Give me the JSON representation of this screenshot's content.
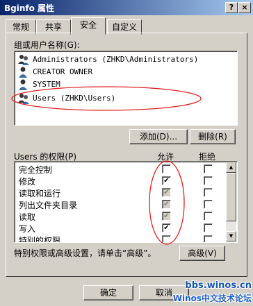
{
  "window": {
    "title": "Bginfo 属性",
    "help_button": "?",
    "close_button": "×"
  },
  "tabs": [
    {
      "label": "常规"
    },
    {
      "label": "共享"
    },
    {
      "label": "安全",
      "active": true
    },
    {
      "label": "自定义"
    }
  ],
  "users_group": {
    "label": "组或用户名称(G):",
    "items": [
      {
        "name": "Administrators (ZHKD\\Administrators)"
      },
      {
        "name": "CREATOR OWNER"
      },
      {
        "name": "SYSTEM"
      },
      {
        "name": "Users (ZHKD\\Users)",
        "selected": true
      }
    ],
    "add_button": "添加(D)...",
    "remove_button": "删除(R)"
  },
  "permissions": {
    "label": "Users 的权限(P)",
    "allow_header": "允许",
    "deny_header": "拒绝",
    "rows": [
      {
        "name": "完全控制",
        "allow": "",
        "deny": ""
      },
      {
        "name": "修改",
        "allow": "✔",
        "deny": ""
      },
      {
        "name": "读取和运行",
        "allow": "✔",
        "deny": ""
      },
      {
        "name": "列出文件夹目录",
        "allow": "✔",
        "deny": ""
      },
      {
        "name": "读取",
        "allow": "✔",
        "deny": ""
      },
      {
        "name": "写入",
        "allow": "✔",
        "deny": ""
      },
      {
        "name": "特别的权限",
        "allow": "",
        "deny": ""
      }
    ]
  },
  "advanced": {
    "hint": "特别权限或高级设置，请单击“高级”。",
    "button": "高级(V)"
  },
  "footer": {
    "ok_button": "确定",
    "cancel_button": "取消"
  },
  "watermark": {
    "line1": "bbs.winos.cn",
    "line2": "Winos中文技术论坛"
  },
  "colors": {
    "title_bar": "#0a246a",
    "dialog_bg": "#d4d0c8",
    "annotation_red": "#e02020"
  }
}
